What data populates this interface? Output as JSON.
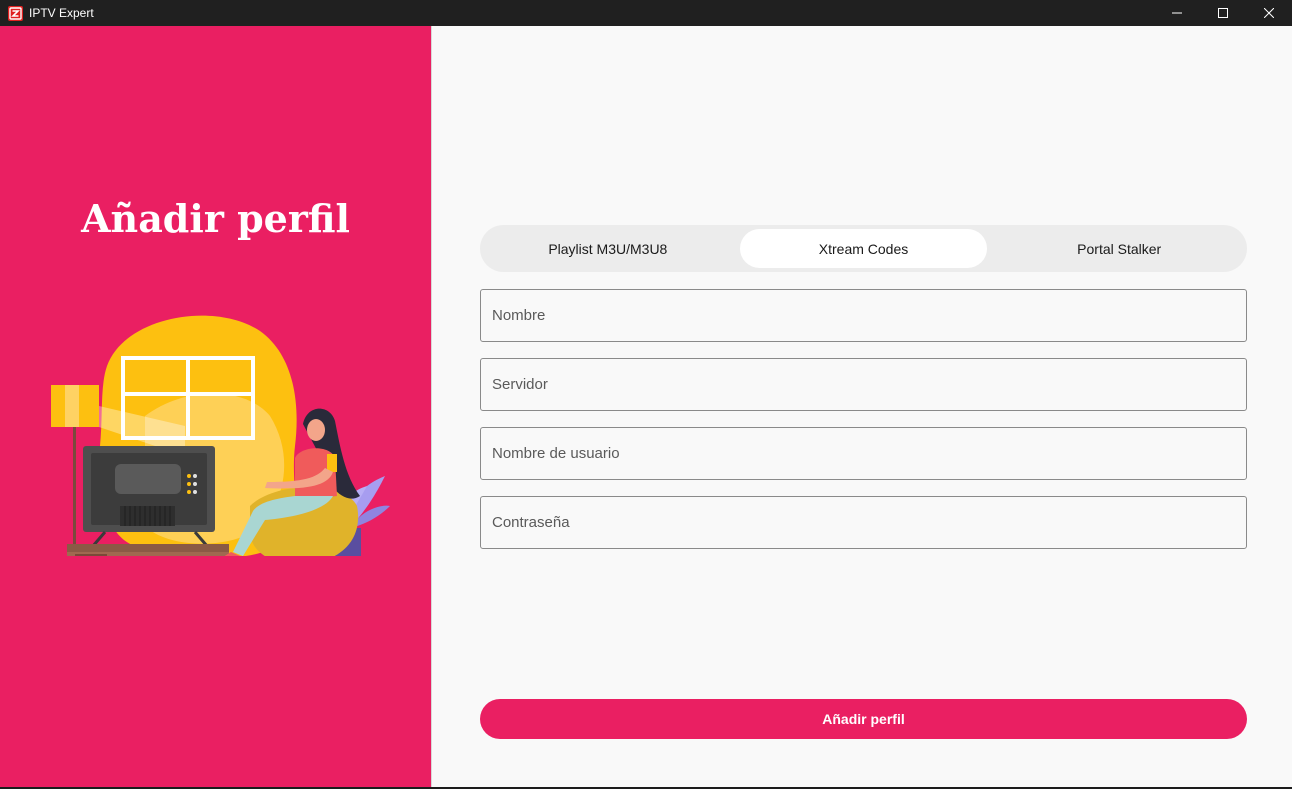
{
  "window": {
    "title": "IPTV Expert",
    "icons": {
      "app": "iptv-expert-logo-icon",
      "minimize": "minimize-icon",
      "maximize": "maximize-icon",
      "close": "close-icon"
    }
  },
  "left": {
    "title": "Añadir perfil",
    "illustration": "woman-watching-tv-illustration"
  },
  "tabs": [
    {
      "label": "Playlist M3U/M3U8",
      "active": false
    },
    {
      "label": "Xtream Codes",
      "active": true
    },
    {
      "label": "Portal Stalker",
      "active": false
    }
  ],
  "form": {
    "name": {
      "placeholder": "Nombre",
      "value": ""
    },
    "server": {
      "placeholder": "Servidor",
      "value": ""
    },
    "username": {
      "placeholder": "Nombre de usuario",
      "value": ""
    },
    "password": {
      "placeholder": "Contraseña",
      "value": ""
    },
    "submit_label": "Añadir perfil"
  },
  "colors": {
    "accent": "#ea1f62",
    "titlebar": "#202020",
    "background": "#f9f9f9",
    "tab_track": "#ececec",
    "tab_active": "#ffffff"
  }
}
